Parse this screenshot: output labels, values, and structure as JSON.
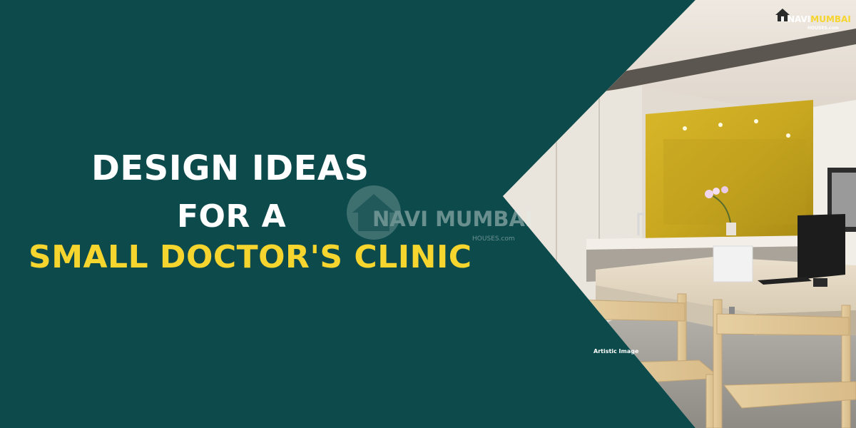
{
  "headline": {
    "line1": "DESIGN IDEAS",
    "line2": "FOR A",
    "line3": "SMALL DOCTOR'S CLINIC"
  },
  "watermark": {
    "text": "NAVI MUMBAI",
    "sub": "HOUSES.com",
    "icon": "house-icon"
  },
  "logo": {
    "navi": "NAVI",
    "mumbai": "MUMBAI",
    "sub": "HOUSES.com",
    "icon": "house-icon"
  },
  "photo": {
    "caption": "Artistic Image"
  },
  "colors": {
    "background": "#0d4a4b",
    "accent_yellow": "#f6d52f",
    "text_white": "#ffffff"
  }
}
